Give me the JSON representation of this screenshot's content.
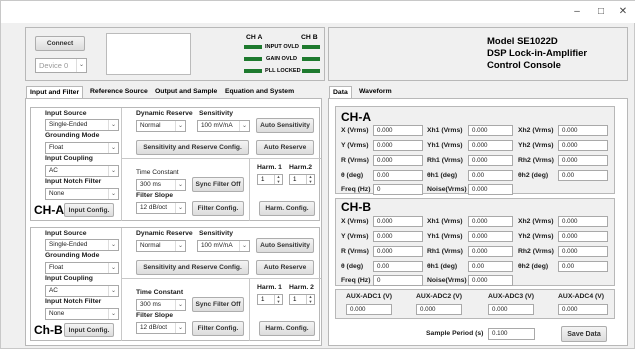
{
  "window": {
    "minimize": "–",
    "maximize": "□",
    "close": "✕"
  },
  "connect": {
    "button": "Connect",
    "device": "Device 0"
  },
  "status": {
    "ch_a": "CH A",
    "ch_b": "CH B",
    "input_ovld": "INPUT OVLD",
    "gain_ovld": "GAIN OVLD",
    "pll_locked": "PLL LOCKED",
    "led_color": "#1e7a2e"
  },
  "header": {
    "model": "Model  SE1022D",
    "title1": "DSP Lock-in-Amplifier",
    "title2": "Control Console"
  },
  "left_tabs": [
    "Input and Filter",
    "Reference Source",
    "Output and Sample",
    "Equation and System"
  ],
  "right_tabs": [
    "Data",
    "Waveform"
  ],
  "cha": {
    "input_source_label": "Input Source",
    "input_source": "Single-Ended",
    "grounding_label": "Grounding Mode",
    "grounding": "Float",
    "coupling_label": "Input Coupling",
    "coupling": "AC",
    "notch_label": "Input Notch Filter",
    "notch": "None",
    "name": "CH-A",
    "input_config": "Input Config.",
    "dyn_label": "Dynamic Reserve",
    "dyn": "Normal",
    "sens_label": "Sensitivity",
    "sens": "100 mV/nA",
    "auto_sens": "Auto Sensitivity",
    "sens_reserve": "Sensitivity and Reserve Config.",
    "auto_reserve": "Auto Reserve",
    "tc_label": "Time Constant",
    "tc": "300 ms",
    "sync": "Sync Filter Off",
    "slope_label": "Filter Slope",
    "slope": "12 dB/oct",
    "filter_config": "Filter Config.",
    "harm1_label": "Harm. 1",
    "harm1": "1",
    "harm2_label": "Harm.2",
    "harm2": "1",
    "harm_config": "Harm. Config."
  },
  "chb": {
    "input_source_label": "Input Source",
    "input_source": "Single-Ended",
    "grounding_label": "Grounding Mode",
    "grounding": "Float",
    "coupling_label": "Input Coupling",
    "coupling": "AC",
    "notch_label": "Input Notch Filter",
    "notch": "None",
    "name": "Ch-B",
    "input_config": "Input Config.",
    "dyn_label": "Dynamic Reserve",
    "dyn": "Normal",
    "sens_label": "Sensitivity",
    "sens": "100 mV/nA",
    "auto_sens": "Auto Sensitivity",
    "sens_reserve": "Sensitivity and Reserve Config.",
    "auto_reserve": "Auto Reserve",
    "tc_label": "Time Constant",
    "tc": "300 ms",
    "sync": "Sync Filter Off",
    "slope_label": "Filter Slope",
    "slope": "12 dB/oct",
    "filter_config": "Filter Config.",
    "harm1_label": "Harm. 1",
    "harm1": "1",
    "harm2_label": "Harm. 2",
    "harm2": "1",
    "harm_config": "Harm. Config."
  },
  "data_a": {
    "title": "CH-A",
    "x": "X (Vrms)",
    "x_v": "0.000",
    "xh1": "Xh1 (Vrms)",
    "xh1_v": "0.000",
    "xh2": "Xh2 (Vrms)",
    "xh2_v": "0.000",
    "y": "Y (Vrms)",
    "y_v": "0.000",
    "yh1": "Yh1 (Vrms)",
    "yh1_v": "0.000",
    "yh2": "Yh2 (Vrms)",
    "yh2_v": "0.000",
    "r": "R (Vrms)",
    "r_v": "0.000",
    "rh1": "Rh1 (Vrms)",
    "rh1_v": "0.000",
    "rh2": "Rh2 (Vrms)",
    "rh2_v": "0.000",
    "t": "θ  (deg)",
    "t_v": "0.00",
    "th1": "θh1  (deg)",
    "th1_v": "0.00",
    "th2": "θh2  (deg)",
    "th2_v": "0.00",
    "f": "Freq (Hz)",
    "f_v": "0",
    "n": "Noise(Vrms)",
    "n_v": "0.000"
  },
  "data_b": {
    "title": "CH-B",
    "x": "X (Vrms)",
    "x_v": "0.000",
    "xh1": "Xh1 (Vrms)",
    "xh1_v": "0.000",
    "xh2": "Xh2 (Vrms)",
    "xh2_v": "0.000",
    "y": "Y (Vrms)",
    "y_v": "0.000",
    "yh1": "Yh1 (Vrms)",
    "yh1_v": "0.000",
    "yh2": "Yh2 (Vrms)",
    "yh2_v": "0.000",
    "r": "R (Vrms)",
    "r_v": "0.000",
    "rh1": "Rh1 (Vrms)",
    "rh1_v": "0.000",
    "rh2": "Rh2 (Vrms)",
    "rh2_v": "0.000",
    "t": "θ  (deg)",
    "t_v": "0.00",
    "th1": "θh1  (deg)",
    "th1_v": "0.00",
    "th2": "θh2  (deg)",
    "th2_v": "0.00",
    "f": "Freq (Hz)",
    "f_v": "0",
    "n": "Noise(Vrms)",
    "n_v": "0.000"
  },
  "aux": {
    "a1": "AUX-ADC1 (V)",
    "a1_v": "0.000",
    "a2": "AUX-ADC2 (V)",
    "a2_v": "0.000",
    "a3": "AUX-ADC3 (V)",
    "a3_v": "0.000",
    "a4": "AUX-ADC4 (V)",
    "a4_v": "0.000"
  },
  "sample": {
    "label": "Sample Period (s)",
    "value": "0.100",
    "save": "Save Data"
  }
}
